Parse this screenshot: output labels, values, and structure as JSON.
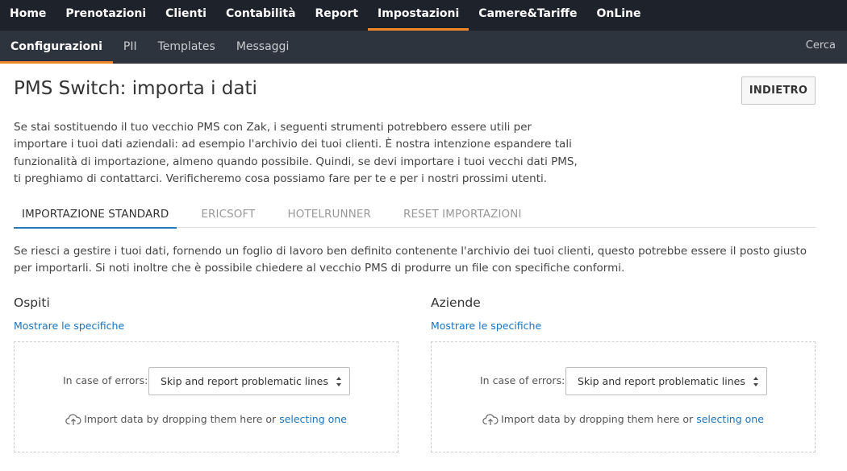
{
  "topnav": {
    "items": [
      "Home",
      "Prenotazioni",
      "Clienti",
      "Contabilità",
      "Report",
      "Impostazioni",
      "Camere&Tariffe",
      "OnLine"
    ],
    "active_index": 5
  },
  "subnav": {
    "items": [
      "Configurazioni",
      "PII",
      "Templates",
      "Messaggi"
    ],
    "active_index": 0,
    "search_label": "Cerca"
  },
  "page": {
    "title": "PMS Switch: importa i dati",
    "back_label": "INDIETRO",
    "intro": "Se stai sostituendo il tuo vecchio PMS con Zak, i seguenti strumenti potrebbero essere utili per importare i tuoi dati aziendali: ad esempio l'archivio dei tuoi clienti. È nostra intenzione espandere tali funzionalità di importazione, almeno quando possibile. Quindi, se devi importare i tuoi vecchi dati PMS, ti preghiamo di contattarci. Verificheremo cosa possiamo fare per te e per i nostri prossimi utenti."
  },
  "tabs": {
    "items": [
      "IMPORTAZIONE STANDARD",
      "ERICSOFT",
      "HOTELRUNNER",
      "RESET IMPORTAZIONI"
    ],
    "active_index": 0,
    "description": "Se riesci a gestire i tuoi dati, fornendo un foglio di lavoro ben definito contenente l'archivio dei tuoi clienti, questo potrebbe essere il posto giusto per importarli. Si noti inoltre che è possibile chiedere al vecchio PMS di produrre un file con specifiche conformi."
  },
  "panels": [
    {
      "title": "Ospiti",
      "spec_link": "Mostrare le specifiche",
      "error_label": "In case of errors:",
      "error_select_value": "Skip and report problematic lines",
      "drop_text": "Import data by dropping them here or",
      "drop_link": "selecting one"
    },
    {
      "title": "Aziende",
      "spec_link": "Mostrare le specifiche",
      "error_label": "In case of errors:",
      "error_select_value": "Skip and report problematic lines",
      "drop_text": "Import data by dropping them here or",
      "drop_link": "selecting one"
    }
  ],
  "colors": {
    "topnav_bg": "#1d222b",
    "subnav_bg": "#2e343e",
    "accent_orange": "#f0872b",
    "link_blue": "#1a74c0",
    "tab_underline": "#2a7ab8"
  },
  "icons": {
    "upload": "cloud-upload-icon",
    "select_arrows": "select-arrows-icon"
  }
}
